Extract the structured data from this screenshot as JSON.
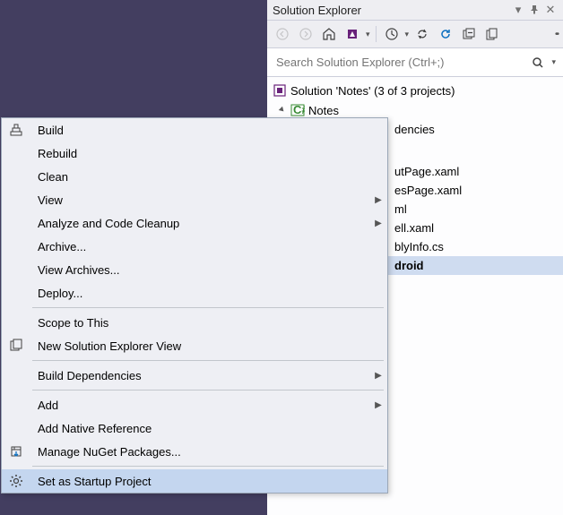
{
  "panel": {
    "title": "Solution Explorer"
  },
  "search": {
    "placeholder": "Search Solution Explorer (Ctrl+;)"
  },
  "tree": {
    "solution": "Solution 'Notes' (3 of 3 projects)",
    "project": "Notes",
    "items": [
      "dencies",
      "utPage.xaml",
      "esPage.xaml",
      "ml",
      "ell.xaml",
      "blyInfo.cs",
      "droid"
    ]
  },
  "menu": {
    "build": "Build",
    "rebuild": "Rebuild",
    "clean": "Clean",
    "view": "View",
    "analyze": "Analyze and Code Cleanup",
    "archive": "Archive...",
    "viewArchives": "View Archives...",
    "deploy": "Deploy...",
    "scope": "Scope to This",
    "newView": "New Solution Explorer View",
    "buildDeps": "Build Dependencies",
    "add": "Add",
    "addNative": "Add Native Reference",
    "nuget": "Manage NuGet Packages...",
    "startup": "Set as Startup Project"
  }
}
